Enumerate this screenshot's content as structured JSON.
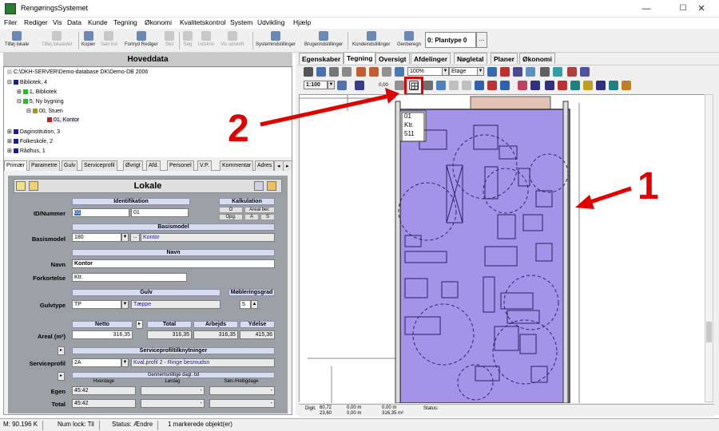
{
  "window": {
    "title": "RengøringsSystemet",
    "minimize": "—",
    "maximize": "☐",
    "close": "✕"
  },
  "menu": [
    "Filer",
    "Rediger",
    "Vis",
    "Data",
    "Kunde",
    "Tegning",
    "Økonomi",
    "Kvalitetskontrol",
    "System",
    "Udvikling",
    "Hjælp"
  ],
  "toolbar": {
    "items": [
      {
        "label": "Tilføj lokale",
        "enabled": true
      },
      {
        "label": "Tilføj lokaledel",
        "enabled": false
      },
      {
        "label": "Kopier",
        "enabled": true
      },
      {
        "label": "Sæt ind",
        "enabled": false
      },
      {
        "label": "Fortryd Rediger",
        "enabled": true
      },
      {
        "label": "Slet",
        "enabled": false
      },
      {
        "label": "Søg",
        "enabled": false
      },
      {
        "label": "Udskriv",
        "enabled": false
      },
      {
        "label": "Vis udskrift",
        "enabled": false
      },
      {
        "label": "Systemindstillinger",
        "enabled": true
      },
      {
        "label": "Brugerindstillinger",
        "enabled": true
      },
      {
        "label": "Kundeindstillinger",
        "enabled": true
      },
      {
        "label": "Genberegn",
        "enabled": true
      }
    ],
    "plantype": "0: Plantype 0",
    "plantype_btn": "..."
  },
  "left": {
    "title": "Hoveddata",
    "tree": [
      {
        "text": "C:\\DKH-SERVER\\Demo-database DK\\Demo-DB 2006",
        "indent": 0,
        "color": ""
      },
      {
        "text": "Bibliotek, 4",
        "indent": 1,
        "color": "#1a1aa0",
        "exp": "⊟"
      },
      {
        "text": "1, Bibliotek",
        "indent": 2,
        "color": "#20c020",
        "exp": "⊞"
      },
      {
        "text": "5, Ny bygning",
        "indent": 2,
        "color": "#20c020",
        "exp": "⊟"
      },
      {
        "text": "00, Stuen",
        "indent": 3,
        "color": "#9a9a20",
        "exp": "⊟"
      },
      {
        "text": "01, Kontor",
        "indent": 4,
        "color": "#c02020",
        "exp": ""
      },
      {
        "text": "Daginstitution, 3",
        "indent": 1,
        "color": "#1a1aa0",
        "exp": "⊞"
      },
      {
        "text": "Folkeskole, 2",
        "indent": 1,
        "color": "#1a1aa0",
        "exp": "⊞"
      },
      {
        "text": "Rådhus, 1",
        "indent": 1,
        "color": "#1a1aa0",
        "exp": "⊞"
      }
    ],
    "tabs": [
      "Primær",
      "Parametre",
      "Gulv",
      "Serviceprofil",
      "Øvrigt",
      "Afd.",
      "Personel",
      "V.P.",
      "Kommentar",
      "Adres"
    ],
    "form": {
      "title": "Lokale",
      "identifikation": "Identifikation",
      "kalkulation": "Kalkulation",
      "id_label": "ID/Nummer",
      "id1": "01",
      "id2": "01",
      "kalk_o": "O",
      "kalk_areal": "Areal ber.",
      "kalk_opg": "Opg.",
      "kalk_a": "A",
      "kalk_s": "S",
      "basismodel_head": "Basismodel",
      "basismodel_label": "Basismodel",
      "basismodel_code": "180",
      "basismodel_btn": "...",
      "basismodel_name": "Kontor",
      "navn_head": "Navn",
      "navn_label": "Navn",
      "navn_value": "Kontor",
      "fork_label": "Forkortelse",
      "fork_value": "Ktr.",
      "gulv_head": "Gulv",
      "mobl_head": "Møbleringsgrad",
      "gulvtype_label": "Gulvtype",
      "gulvtype_code": "TP",
      "gulvtype_name": "Tæppe",
      "mobl_value": "5",
      "areal_label": "Areal (m²)",
      "netto_head": "Netto",
      "total_head": "Total",
      "arbejds_head": "Arbejds",
      "ydelse_head": "Ydelse",
      "netto": "316,35",
      "total": "316,35",
      "arbejds": "316,35",
      "ydelse": "415,36",
      "svc_head": "Serviceprofiltilknytninger",
      "svc_label": "Serviceprofil",
      "svc_code": "2A",
      "svc_name": "Kval.profil 2 - Ringe besmudsn",
      "gns_head": "Gennemsnitlige dagl. tid",
      "hverdage": "Hverdage",
      "lordag": "Lørdag",
      "sonhelligdage": "Søn-/Helligdage",
      "egen_label": "Egen",
      "total_label": "Total",
      "egen_hverdag": "45:42",
      "total_hverdag": "45:42",
      "dash": "-"
    }
  },
  "right": {
    "tabs": [
      "Egenskaber",
      "Tegning",
      "Oversigt",
      "Afdelinger",
      "Nøgletal",
      "Planer",
      "Økonomi"
    ],
    "active_tab": "Tegning",
    "zoom": "100%",
    "level": "Etage",
    "scale": "1:100",
    "lineval": "0,00",
    "room_label": [
      "01",
      "Ktr.",
      "511"
    ],
    "coords": {
      "digit_label": "Digit.",
      "x": "60,72",
      "y": "23,60",
      "dx": "0,00 m",
      "dy": "0,00 m",
      "dz": "0,00 m",
      "area": "316,35 m²",
      "status_label": "Status:"
    }
  },
  "annotations": {
    "one": "1",
    "two": "2",
    "color": "#e10000"
  },
  "statusbar": {
    "memory": "M: 90.196 K",
    "numlock": "Num lock: Til",
    "status": "Status: Ændre",
    "marked": "1 markerede objekt(er)"
  }
}
